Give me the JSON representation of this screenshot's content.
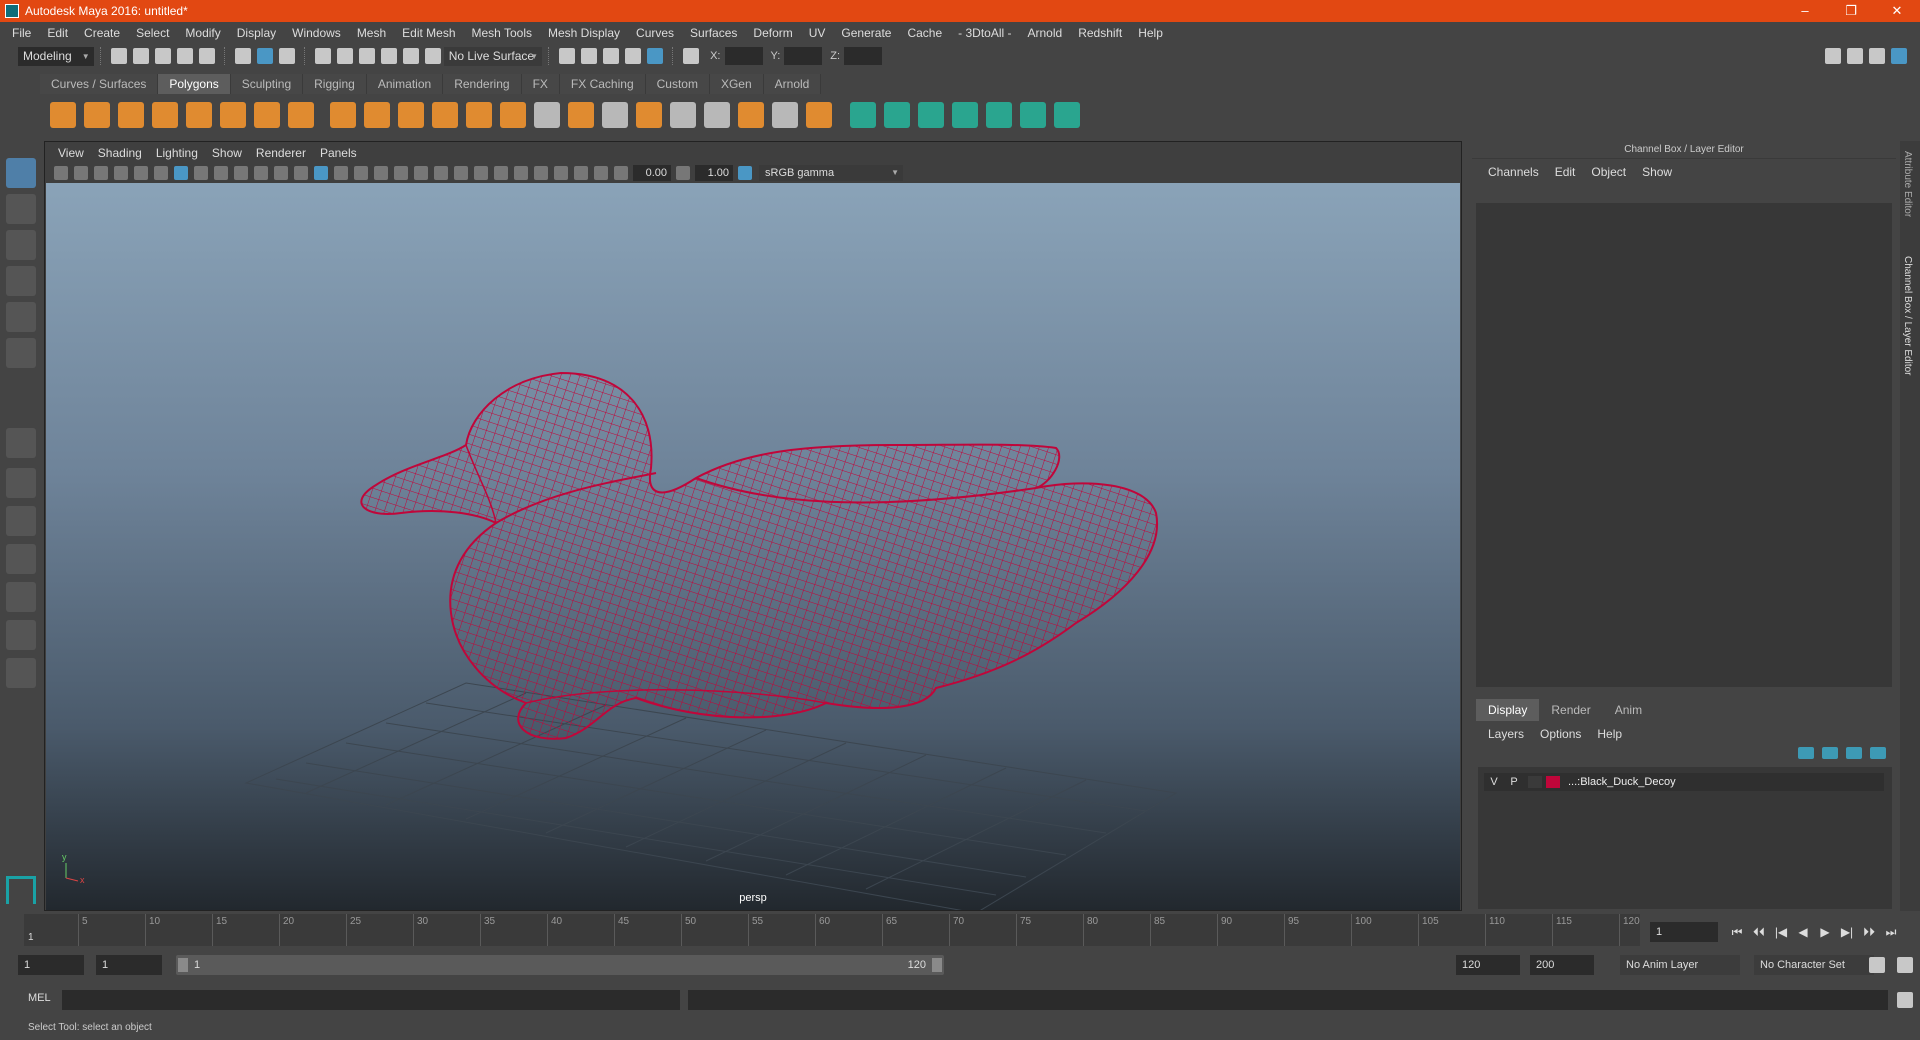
{
  "app": {
    "title": "Autodesk Maya 2016: untitled*"
  },
  "window_buttons": {
    "minimize": "–",
    "maximize": "❐",
    "close": "✕"
  },
  "menu": [
    "File",
    "Edit",
    "Create",
    "Select",
    "Modify",
    "Display",
    "Windows",
    "Mesh",
    "Edit Mesh",
    "Mesh Tools",
    "Mesh Display",
    "Curves",
    "Surfaces",
    "Deform",
    "UV",
    "Generate",
    "Cache",
    "- 3DtoAll -",
    "Arnold",
    "Redshift",
    "Help"
  ],
  "status_line": {
    "mode": "Modeling",
    "live_surface": "No Live Surface",
    "x_label": "X:",
    "y_label": "Y:",
    "z_label": "Z:"
  },
  "shelf": {
    "tabs": [
      "Curves / Surfaces",
      "Polygons",
      "Sculpting",
      "Rigging",
      "Animation",
      "Rendering",
      "FX",
      "FX Caching",
      "Custom",
      "XGen",
      "Arnold"
    ],
    "active_tab": "Polygons",
    "icon_colors": {
      "primitives": "#e08b30",
      "tools": "#2aa58f",
      "neutral": "#b8b8b8"
    }
  },
  "viewport": {
    "menu": [
      "View",
      "Shading",
      "Lighting",
      "Show",
      "Renderer",
      "Panels"
    ],
    "exposure": "0.00",
    "gamma": "1.00",
    "color_space": "sRGB gamma",
    "camera_label": "persp",
    "wireframe_color": "#c0063a",
    "axis": {
      "y": "y",
      "x": "x"
    }
  },
  "channel_box": {
    "header": "Channel Box / Layer Editor",
    "menu": [
      "Channels",
      "Edit",
      "Object",
      "Show"
    ]
  },
  "layer_editor": {
    "tabs": [
      "Display",
      "Render",
      "Anim"
    ],
    "active_tab": "Display",
    "menu": [
      "Layers",
      "Options",
      "Help"
    ],
    "layers": [
      {
        "visible": "V",
        "playback": "P",
        "color": "#c0063a",
        "name": "...:Black_Duck_Decoy"
      }
    ]
  },
  "side_tabs": {
    "attribute_editor": "Attribute Editor",
    "channel_box": "Channel Box / Layer Editor"
  },
  "time_slider": {
    "ticks": [
      "5",
      "10",
      "15",
      "20",
      "25",
      "30",
      "35",
      "40",
      "45",
      "50",
      "55",
      "60",
      "65",
      "70",
      "75",
      "80",
      "85",
      "90",
      "95",
      "100",
      "105",
      "110",
      "115",
      "120"
    ],
    "current_frame_marker": "1",
    "current_frame": "1",
    "playback_buttons": [
      "⏮",
      "⏴⏴",
      "|◀",
      "◀",
      "▶",
      "▶|",
      "⏵⏵",
      "⏭"
    ]
  },
  "range_slider": {
    "start_time": "1",
    "playback_start": "1",
    "range_low": "1",
    "range_high": "120",
    "playback_end": "120",
    "end_time": "200",
    "anim_layer": "No Anim Layer",
    "character_set": "No Character Set"
  },
  "command_line": {
    "label": "MEL"
  },
  "help_line": {
    "text": "Select Tool: select an object"
  }
}
